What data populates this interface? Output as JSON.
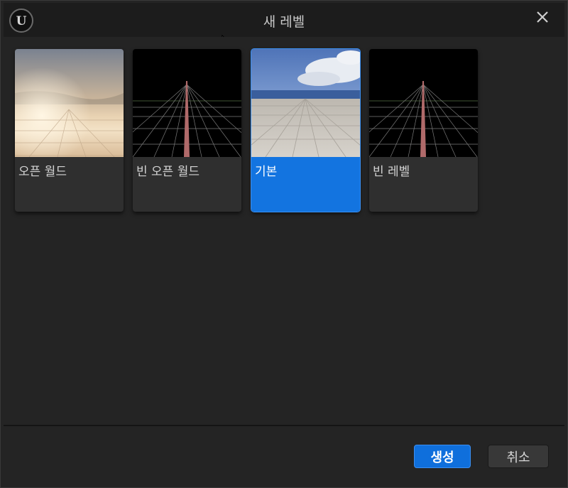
{
  "dialog": {
    "title": "새 레벨",
    "logo_icon": "unreal-engine-logo",
    "close_icon": "close-icon"
  },
  "templates": [
    {
      "label": "오픈 월드",
      "thumbnail": "desert-sky-thumbnail",
      "selected": false
    },
    {
      "label": "빈 오픈 월드",
      "thumbnail": "black-grid-thumbnail",
      "selected": false
    },
    {
      "label": "기본",
      "thumbnail": "sky-floor-thumbnail",
      "selected": true
    },
    {
      "label": "빈 레벨",
      "thumbnail": "black-grid-thumbnail",
      "selected": false
    }
  ],
  "footer": {
    "create_label": "생성",
    "cancel_label": "취소"
  },
  "colors": {
    "accent": "#1374e0",
    "background": "#242424",
    "card": "#2f2f2f"
  }
}
